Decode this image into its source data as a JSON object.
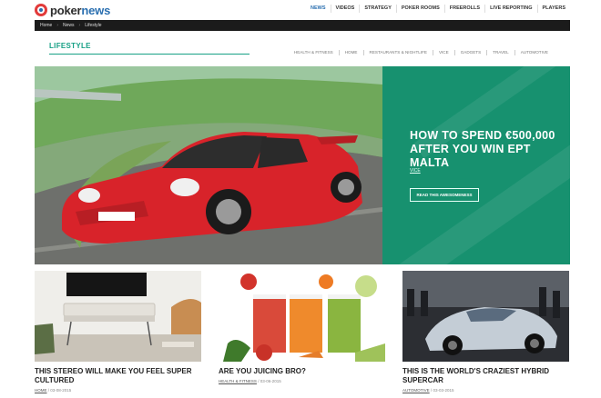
{
  "logo": {
    "part1": "poker",
    "part2": "news"
  },
  "topnav": [
    "NEWS",
    "VIDEOS",
    "STRATEGY",
    "POKER ROOMS",
    "FREEROLLS",
    "LIVE REPORTING",
    "PLAYERS"
  ],
  "breadcrumb": [
    "Home",
    "News",
    "Lifestyle"
  ],
  "section": {
    "title": "LIFESTYLE",
    "subnav": [
      "Health & Fitness",
      "Home",
      "Restaurants & Nightlife",
      "Vice",
      "Gadgets",
      "Travel",
      "Automotive"
    ]
  },
  "hero": {
    "headline": "HOW TO SPEND €500,000 AFTER YOU WIN EPT MALTA",
    "tag": "VICE",
    "button": "READ THIS AWESOMENESS"
  },
  "cards": [
    {
      "title": "THIS STEREO WILL MAKE YOU FEEL SUPER CULTURED",
      "category": "HOME",
      "date": "03-08-2015"
    },
    {
      "title": "ARE YOU JUICING BRO?",
      "category": "HEALTH & FITNESS",
      "date": "03-06-2015"
    },
    {
      "title": "THIS IS THE WORLD'S CRAZIEST HYBRID SUPERCAR",
      "category": "AUTOMOTIVE",
      "date": "03-03-2015"
    }
  ],
  "colors": {
    "accent": "#16a085",
    "hero_panel": "#17916f",
    "brand_blue": "#2a6fb0",
    "brand_red": "#e23b3b"
  }
}
